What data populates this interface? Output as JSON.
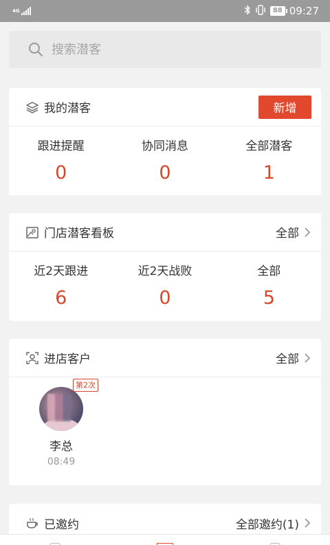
{
  "status_bar": {
    "network": "4G",
    "battery": "88",
    "time": "09:27"
  },
  "search": {
    "placeholder": "搜索潜客"
  },
  "my_leads": {
    "title": "我的潜客",
    "add_label": "新增",
    "stats": [
      {
        "label": "跟进提醒",
        "value": "0"
      },
      {
        "label": "协同消息",
        "value": "0"
      },
      {
        "label": "全部潜客",
        "value": "1"
      }
    ]
  },
  "store_board": {
    "title": "门店潜客看板",
    "link": "全部",
    "stats": [
      {
        "label": "近2天跟进",
        "value": "6"
      },
      {
        "label": "近2天战败",
        "value": "0"
      },
      {
        "label": "全部",
        "value": "5"
      }
    ]
  },
  "store_visitors": {
    "title": "进店客户",
    "link": "全部",
    "customers": [
      {
        "name": "李总",
        "time": "08:49",
        "badge": "第2次"
      }
    ]
  },
  "invited": {
    "title": "已邀约",
    "link": "全部邀约(1)"
  },
  "colors": {
    "accent": "#e2482d",
    "value_red": "#d9472a",
    "background": "#f2f2f2"
  }
}
